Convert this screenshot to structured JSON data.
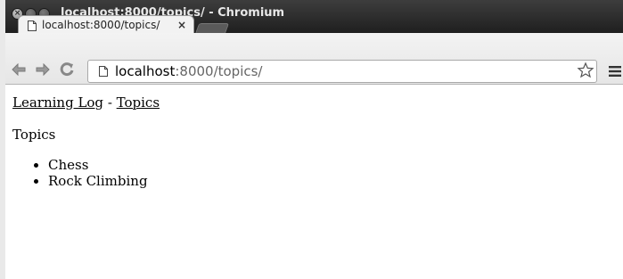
{
  "window": {
    "title": "localhost:8000/topics/ - Chromium",
    "close_glyph": "×"
  },
  "tab": {
    "title": "localhost:8000/topics/",
    "close_glyph": "×"
  },
  "addressbar": {
    "url_host": "localhost",
    "url_path": ":8000/topics/"
  },
  "icons": {
    "back": "back-arrow-icon",
    "forward": "forward-arrow-icon",
    "reload": "reload-icon",
    "page": "page-icon",
    "bookmark": "star-icon",
    "menu": "hamburger-menu-icon"
  },
  "page": {
    "site_link": "Learning Log",
    "separator": " - ",
    "topics_link": "Topics",
    "heading": "Topics",
    "topics": [
      "Chess",
      "Rock Climbing"
    ]
  }
}
